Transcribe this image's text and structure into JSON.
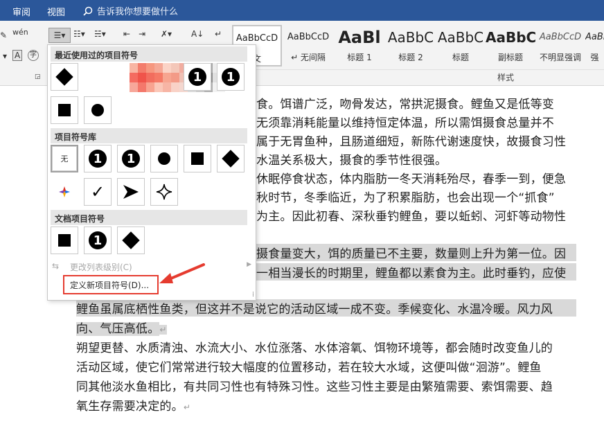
{
  "topbar": {
    "tabs": [
      "审阅",
      "视图"
    ],
    "tell_me": "告诉我你想要做什么"
  },
  "ribbon": {
    "styles_label": "样式",
    "style_items": [
      {
        "preview": "AaBbCcD",
        "name": "文"
      },
      {
        "preview": "AaBbCcD",
        "name": "↵ 无间隔"
      },
      {
        "preview": "AaBl",
        "name": "标题 1"
      },
      {
        "preview": "AaBbC",
        "name": "标题 2"
      },
      {
        "preview": "AaBbC",
        "name": "标题"
      },
      {
        "preview": "AaBbC",
        "name": "副标题"
      },
      {
        "preview": "AaBbCcD",
        "name": "不明显强调"
      },
      {
        "preview": "AaBb",
        "name": "强"
      }
    ]
  },
  "panel": {
    "recent_title": "最近使用过的项目符号",
    "library_title": "项目符号库",
    "doc_title": "文档项目符号",
    "none_label": "无",
    "change_level": "更改列表级别(C)",
    "define_new": "定义新项目符号(D)..."
  },
  "document": {
    "lines": [
      "食。饵谱广泛，吻骨发达，常拱泥摄食。鲤鱼又是低等变",
      "无须靠消耗能量以维持恒定体温，所以需饵摄食总量并不",
      "属于无胃鱼种，且肠道细短，新陈代谢速度快，故摄食习性",
      "水温关系极大，摄食的季节性很强。",
      "休眠停食状态，体内脂肪一冬天消耗殆尽，春季一到，便急",
      "秋时节，冬季临近，为了积累脂肪，也会出现一个“抓食”",
      "为主。因此初春、深秋垂钓鲤鱼，要以蚯蚓、河虾等动物性",
      "摄食量变大，饵的质量已不主要，数量则上升为第一位。因",
      "一相当漫长的时期里，鲤鱼都以素食为主。此时垂钓，应使",
      "鲤鱼虽属底栖性鱼类，但这并不是说它的活动区域一成不变。季候变化、水温冷暖。风力风",
      "向、气压高低。",
      "朔望更替、水质清浊、水流大小、水位涨落、水体溶氧、饵物环境等，都会随时改变鱼儿的",
      "活动区域，使它们常常进行较大幅度的位置移动，若在较大水域，这便叫做“洄游”。鲤鱼",
      "同其他淡水鱼相比，有共同习性也有特殊习性。这些习性主要是由繁殖需要、索饵需要、趋",
      "氧生存需要决定的。"
    ],
    "para_mark": "↵"
  },
  "colors": {
    "topbar": "#2b579a",
    "highlight": "#d9d9d9",
    "annotation": "#e53b2f"
  }
}
